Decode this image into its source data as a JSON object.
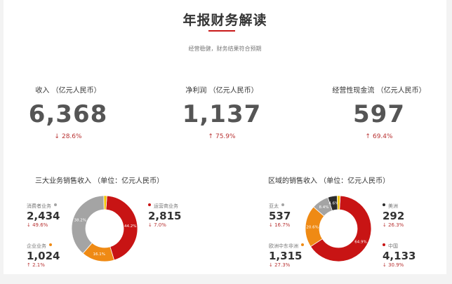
{
  "header": {
    "title": "年报财务解读",
    "subtitle": "经营稳健，财务结果符合预期"
  },
  "kpis": [
    {
      "label": "收入 （亿元人民币）",
      "value": "6,368",
      "direction": "down",
      "change": "28.6%"
    },
    {
      "label": "净利润 （亿元人民币）",
      "value": "1,137",
      "direction": "up",
      "change": "75.9%"
    },
    {
      "label": "经营性现金流 （亿元人民币）",
      "value": "597",
      "direction": "up",
      "change": "69.4%"
    }
  ],
  "colors": {
    "red": "#c81414",
    "orange": "#ef8a14",
    "gray": "#a4a4a4",
    "dark": "#2d2d2d",
    "accent": "#c81919"
  },
  "chart_data": [
    {
      "type": "pie",
      "title": "三大业务销售收入 （单位：亿元人民币）",
      "slices": [
        {
          "name": "运营商业务",
          "value": "2,815",
          "change": "↓ 7.0%",
          "percent": 44.2,
          "label": "44.2%",
          "color": "#c81414"
        },
        {
          "name": "企业业务",
          "value": "1,024",
          "change": "↑ 2.1%",
          "percent": 16.1,
          "label": "16.1%",
          "color": "#ef8a14"
        },
        {
          "name": "消费者业务",
          "value": "2,434",
          "change": "↓ 49.6%",
          "percent": 38.2,
          "label": "38.2%",
          "color": "#a4a4a4"
        },
        {
          "name": "",
          "value": "",
          "change": "",
          "percent": 1.5,
          "label": "",
          "color": "#f2c200"
        }
      ]
    },
    {
      "type": "pie",
      "title": "区域的销售收入 （单位：亿元人民币）",
      "slices": [
        {
          "name": "中国",
          "value": "4,133",
          "change": "↓ 30.9%",
          "percent": 64.9,
          "label": "64.9%",
          "color": "#c81414"
        },
        {
          "name": "欧洲中东非洲",
          "value": "1,315",
          "change": "↓ 27.3%",
          "percent": 20.6,
          "label": "20.6%",
          "color": "#ef8a14"
        },
        {
          "name": "亚太",
          "value": "537",
          "change": "↓ 16.7%",
          "percent": 8.4,
          "label": "8.4%",
          "color": "#a4a4a4"
        },
        {
          "name": "美洲",
          "value": "292",
          "change": "↓ 26.3%",
          "percent": 4.6,
          "label": "4.6%",
          "color": "#2d2d2d"
        },
        {
          "name": "",
          "value": "",
          "change": "",
          "percent": 1.5,
          "label": "",
          "color": "#f2c200"
        }
      ]
    }
  ]
}
